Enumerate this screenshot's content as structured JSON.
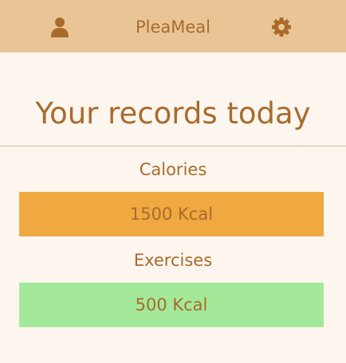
{
  "header": {
    "title": "PleaMeal",
    "user_icon": "user-icon",
    "settings_icon": "gear-icon"
  },
  "main": {
    "title": "Your records today",
    "calories": {
      "label": "Calories",
      "value": "1500 Kcal"
    },
    "exercises": {
      "label": "Exercises",
      "value": "500 Kcal"
    }
  },
  "colors": {
    "header_bg": "#e9c596",
    "page_bg": "#fdf6ef",
    "text": "#a86b2c",
    "calories_bar": "#f0a841",
    "exercises_bar": "#a4e99a"
  }
}
